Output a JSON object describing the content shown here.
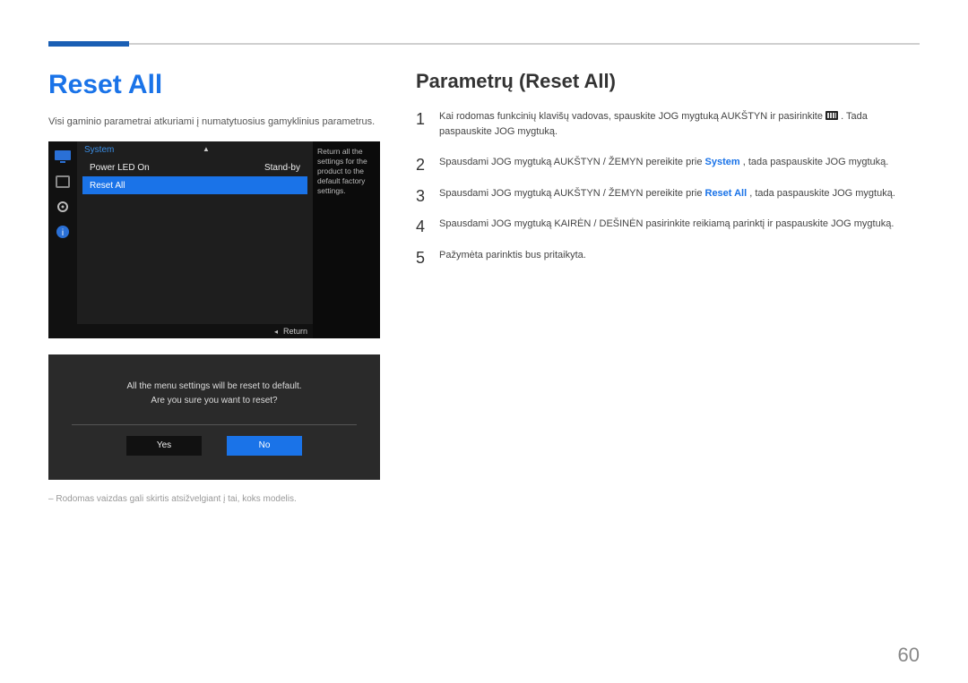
{
  "page_number": "60",
  "left": {
    "title": "Reset All",
    "intro": "Visi gaminio parametrai atkuriami į numatytuosius gamyklinius parametrus.",
    "osd1": {
      "header": "System",
      "tooltip": "Return all the settings for the product to the default factory settings.",
      "row_power_led_label": "Power LED On",
      "row_power_led_value": "Stand-by",
      "row_reset_label": "Reset All",
      "return_label": "Return"
    },
    "osd2": {
      "msg1": "All the menu settings will be reset to default.",
      "msg2": "Are you sure you want to reset?",
      "yes": "Yes",
      "no": "No"
    },
    "footnote": "Rodomas vaizdas gali skirtis atsižvelgiant į tai, koks modelis."
  },
  "right": {
    "title": "Parametrų (Reset All)",
    "step1_a": "Kai rodomas funkcinių klavišų vadovas, spauskite JOG mygtuką AUKŠTYN ir pasirinkite ",
    "step1_b": ". Tada paspauskite JOG mygtuką.",
    "step2_a": "Spausdami JOG mygtuką AUKŠTYN / ŽEMYN pereikite prie ",
    "step2_bold": "System",
    "step2_b": ", tada paspauskite JOG mygtuką.",
    "step3_a": "Spausdami JOG mygtuką AUKŠTYN / ŽEMYN pereikite prie ",
    "step3_bold": "Reset All",
    "step3_b": ", tada paspauskite JOG mygtuką.",
    "step4": "Spausdami JOG mygtuką KAIRĖN / DEŠINĖN pasirinkite reikiamą parinktį ir paspauskite JOG mygtuką.",
    "step5": "Pažymėta parinktis bus pritaikyta."
  }
}
